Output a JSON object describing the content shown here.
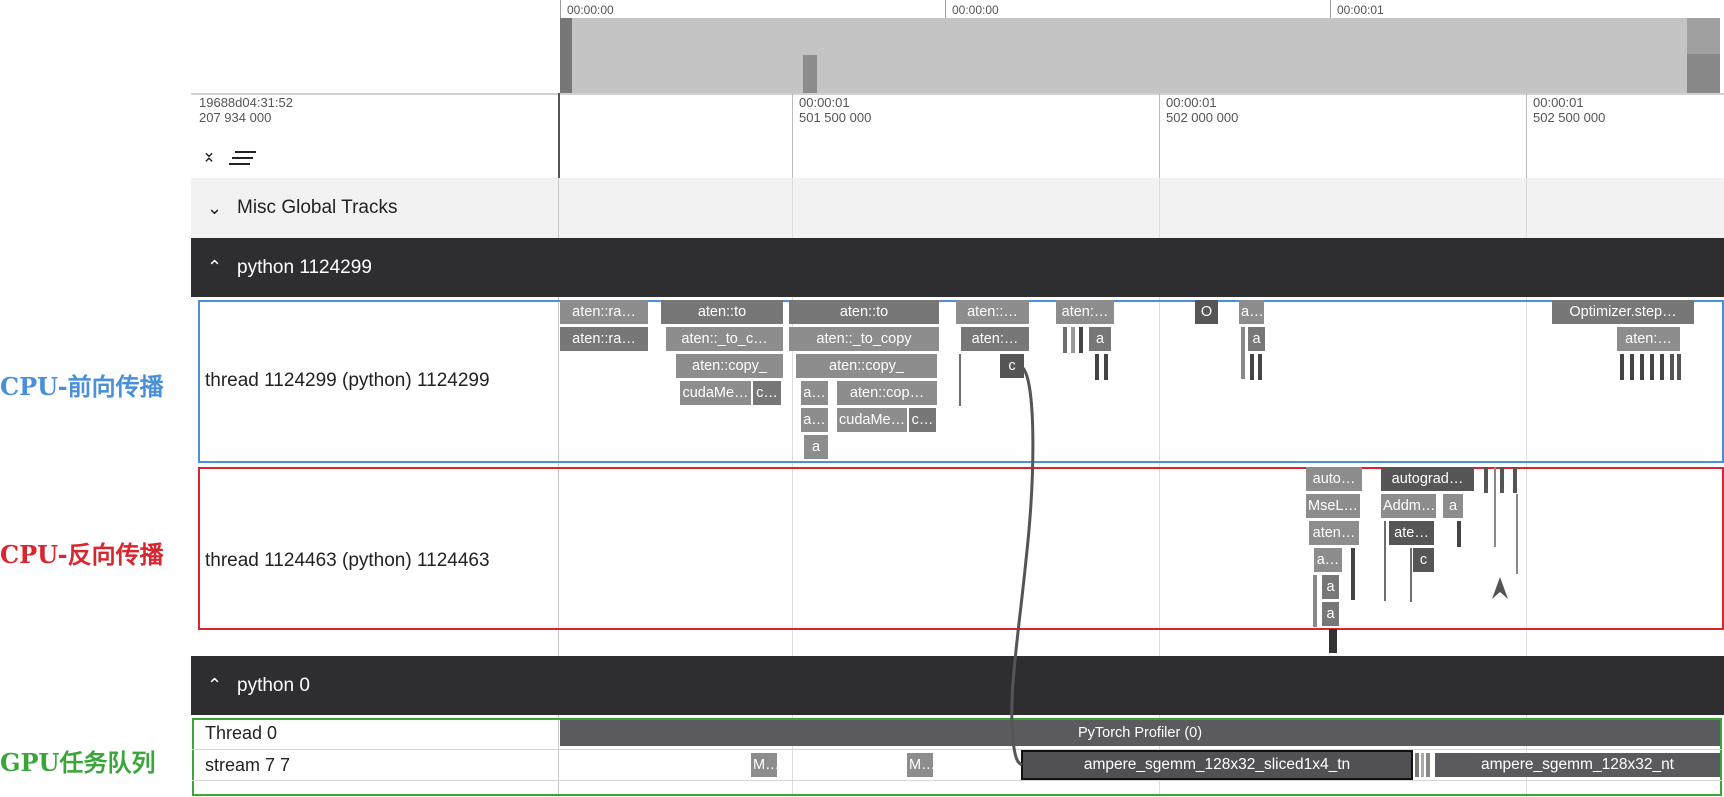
{
  "overview": {
    "ticks": [
      "00:00:00",
      "00:00:00",
      "00:00:01"
    ]
  },
  "ruler": {
    "left_line1": "19688d04:31:52",
    "left_line2": "207 934 000",
    "ticks": [
      {
        "l1": "00:00:01",
        "l2": "501 500 000"
      },
      {
        "l1": "00:00:01",
        "l2": "502 000 000"
      },
      {
        "l1": "00:00:01",
        "l2": "502 500 000"
      }
    ]
  },
  "groups": {
    "misc": "Misc Global Tracks",
    "proc1": "python 1124299",
    "proc2": "python 0"
  },
  "threads": {
    "fwd": "thread 1124299 (python) 1124299",
    "bwd": "thread 1124463 (python) 1124463",
    "gpu_thread": "Thread 0",
    "gpu_stream": "stream 7 7"
  },
  "annotations": {
    "fwd": "CPU-前向传播",
    "bwd": "CPU-反向传播",
    "gpu": "GPU任务队列"
  },
  "colors": {
    "fwd_box": "#4a90d9",
    "bwd_box": "#d9252e",
    "gpu_box": "#3aa63a",
    "proc_header": "#2e2e30"
  },
  "slices": {
    "fwd": {
      "a1": "aten::ra…",
      "a2": "aten::ra…",
      "b1": "aten::to",
      "b2": "aten::_to_c…",
      "b3": "aten::copy_",
      "b4": "cudaMe…",
      "b5": "c…",
      "c1": "aten::to",
      "c2": "aten::_to_copy",
      "c3": "aten::copy_",
      "c4": "a…",
      "c5": "aten::cop…",
      "c6": "a…",
      "c7": "cudaMe…",
      "c8": "c…",
      "c9": "a",
      "d1": "aten::…",
      "d2": "aten:…",
      "d3": "c",
      "e1": "aten:…",
      "e2": "a",
      "f1": "O",
      "g1": "a…",
      "g2": "a",
      "h1": "Optimizer.step…",
      "h2": "aten:…"
    },
    "bwd": {
      "a1": "auto…",
      "a2": "MseL…",
      "a3": "aten…",
      "a4": "a…",
      "a5": "a",
      "a6": "a",
      "b1": "autograd…",
      "b2": "Addm…",
      "b3": "a",
      "b4": "ate…",
      "b5": "c"
    },
    "gpu": {
      "profiler": "PyTorch Profiler (0)",
      "m1": "M…",
      "m2": "M…",
      "k1": "ampere_sgemm_128x32_sliced1x4_tn",
      "k2": "ampere_sgemm_128x32_nt"
    }
  }
}
